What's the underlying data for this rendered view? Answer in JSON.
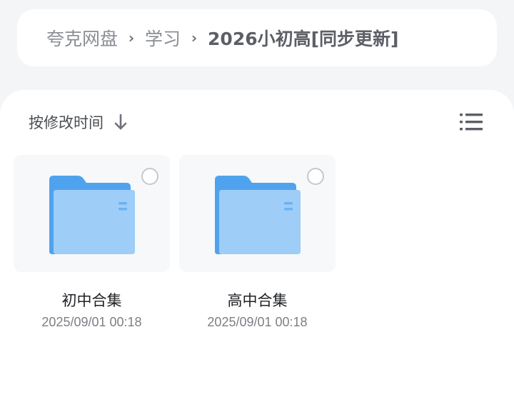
{
  "breadcrumb": {
    "items": [
      {
        "label": "夸克网盘"
      },
      {
        "label": "学习"
      },
      {
        "label": "2026小初高[同步更新]"
      }
    ],
    "separator": "›"
  },
  "toolbar": {
    "sort_label": "按修改时间",
    "sort_icon": "arrow-down-icon",
    "view_icon": "list-view-icon"
  },
  "files": [
    {
      "name": "初中合集",
      "date": "2025/09/01 00:18",
      "icon": "folder-icon"
    },
    {
      "name": "高中合集",
      "date": "2025/09/01 00:18",
      "icon": "folder-icon"
    }
  ],
  "colors": {
    "folder_back": "#4fa3ee",
    "folder_front": "#9ecdf7",
    "background": "#f4f5f7"
  }
}
